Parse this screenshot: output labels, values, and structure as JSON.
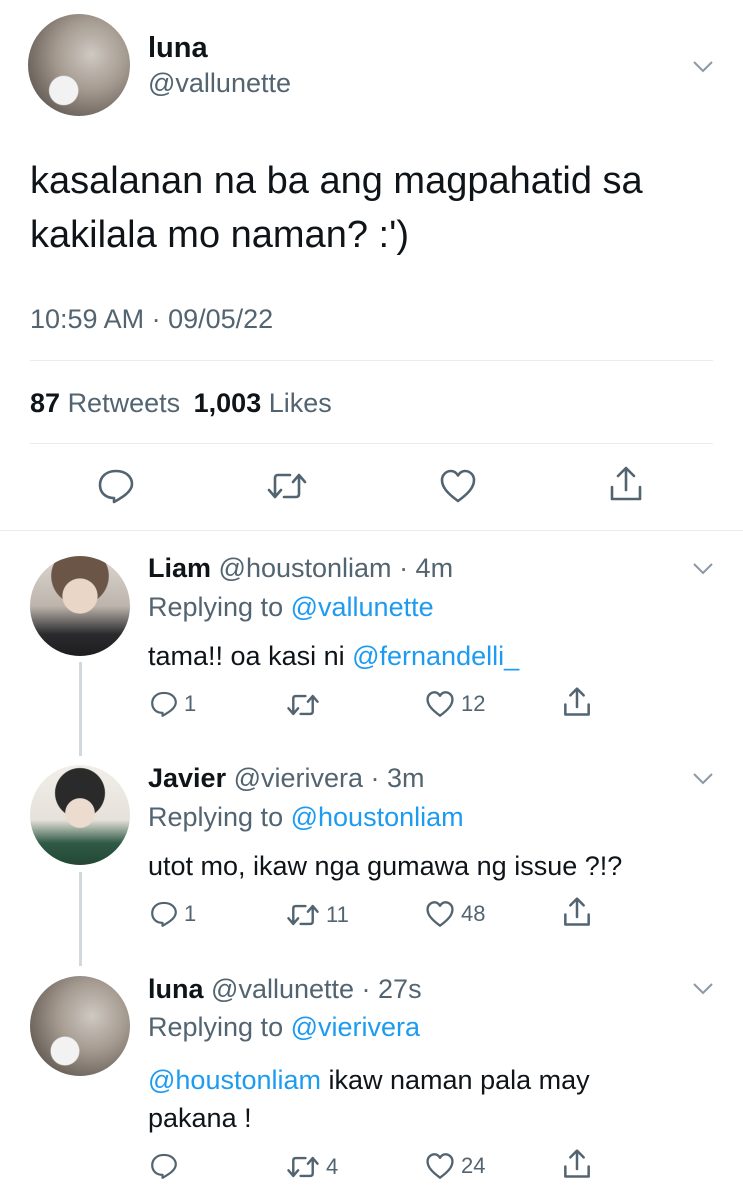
{
  "main_tweet": {
    "display_name": "luna",
    "handle": "@vallunette",
    "text_line1": "kasalanan na ba ang magpahatid sa",
    "text_line2": "kakilala mo naman? :')",
    "timestamp": "10:59 AM · 09/05/22",
    "retweets_count": "87",
    "retweets_label": "Retweets",
    "likes_count": "1,003",
    "likes_label": "Likes"
  },
  "replies": [
    {
      "display_name": "Liam",
      "handle": "@houstonliam",
      "time": "· 4m",
      "replying_prefix": "Replying to",
      "replying_to": "@vallunette",
      "text": "tama!! oa kasi ni ",
      "mention": "@fernandelli_",
      "reply_count": "1",
      "retweet_count": "",
      "like_count": "12"
    },
    {
      "display_name": "Javier",
      "handle": "@vierivera",
      "time": "· 3m",
      "replying_prefix": "Replying to",
      "replying_to": "@houstonliam",
      "text": "utot mo, ikaw nga gumawa ng issue ?!?",
      "reply_count": "1",
      "retweet_count": "11",
      "like_count": "48"
    },
    {
      "display_name": "luna",
      "handle": "@vallunette",
      "time": "· 27s",
      "replying_prefix": "Replying to",
      "replying_to": "@vierivera",
      "mention": "@houstonliam",
      "text_line1": " ikaw naman pala may",
      "text_line2": "pakana !",
      "reply_count": "",
      "retweet_count": "4",
      "like_count": "24"
    }
  ],
  "icons": {
    "reply": "reply-icon",
    "retweet": "retweet-icon",
    "like": "heart-icon",
    "share": "share-icon",
    "more": "chevron-down-icon"
  },
  "colors": {
    "link": "#1d9bf0",
    "muted": "#536471",
    "text": "#0f1419",
    "divider": "#e6ecf0"
  }
}
